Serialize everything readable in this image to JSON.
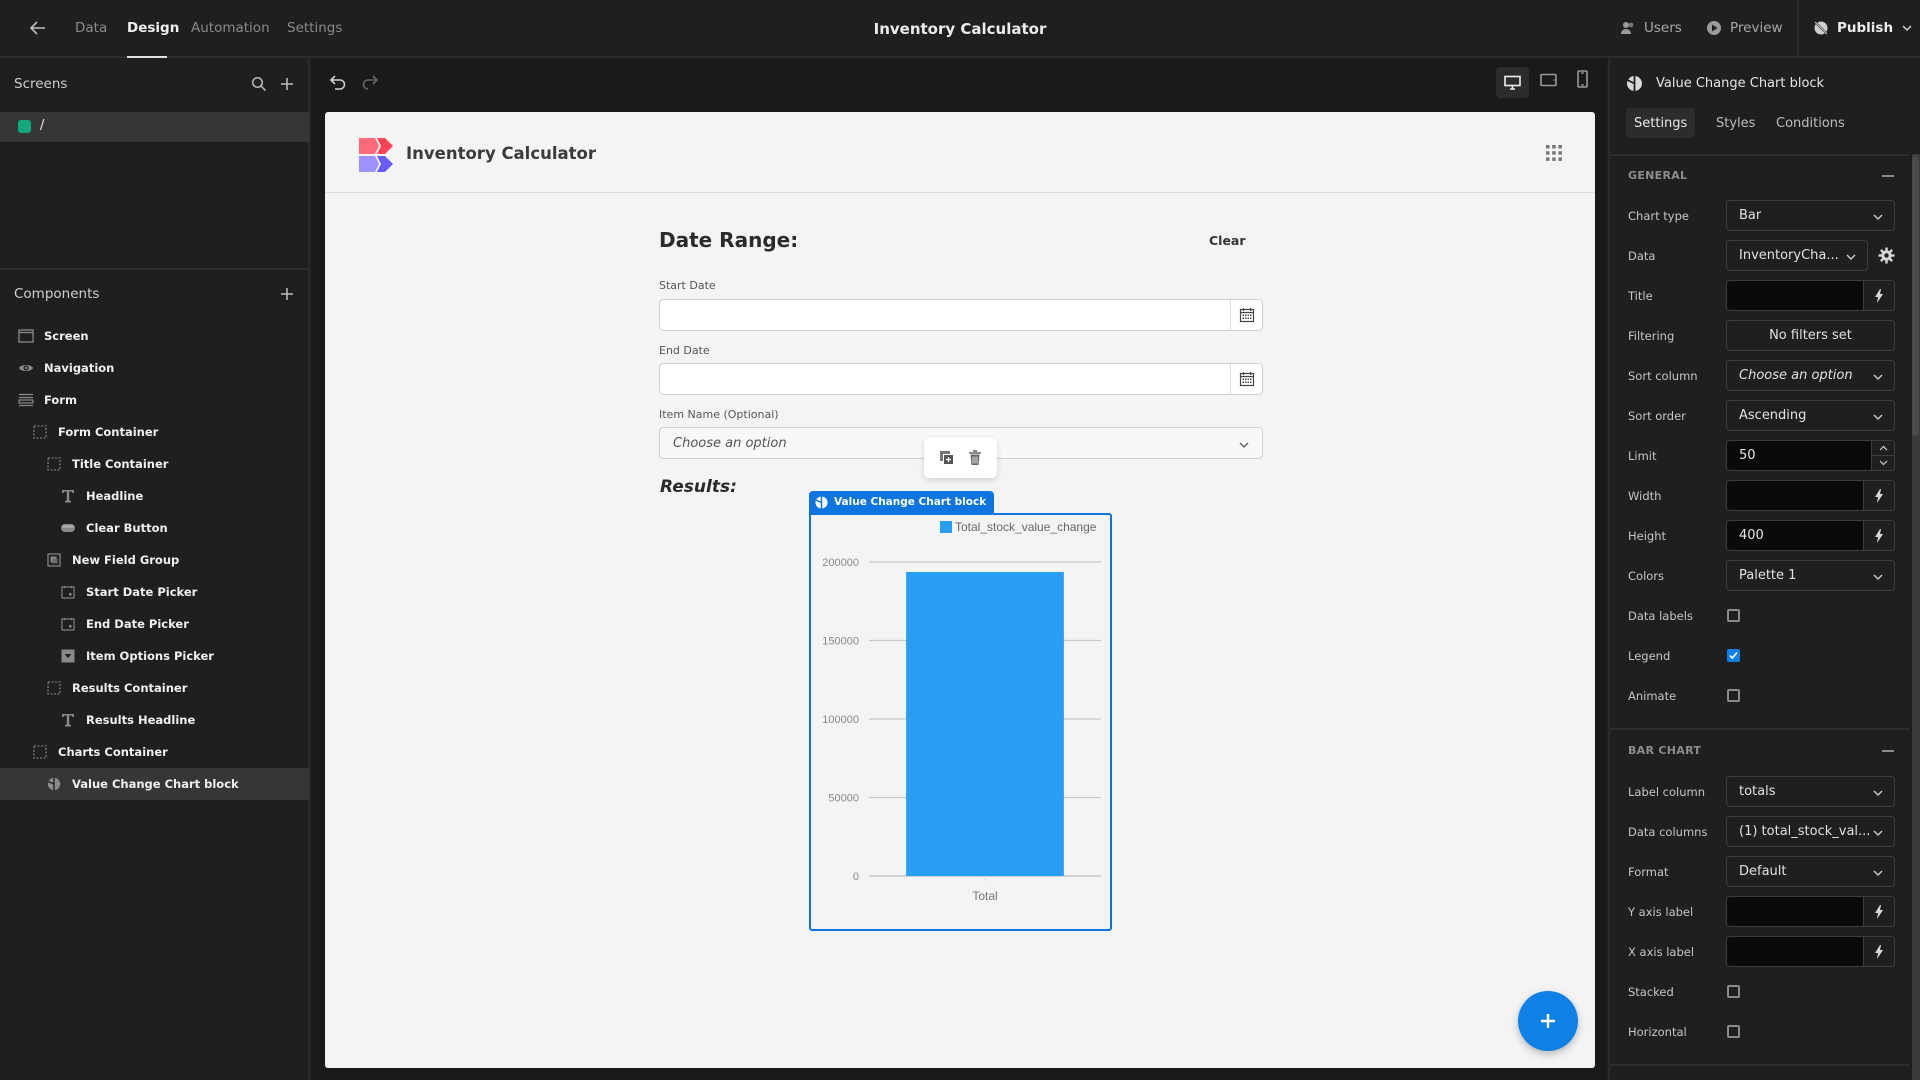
{
  "topbar": {
    "back_icon": "arrow-left-icon",
    "tabs": [
      {
        "label": "Data",
        "active": false
      },
      {
        "label": "Design",
        "active": true
      },
      {
        "label": "Automation",
        "active": false
      },
      {
        "label": "Settings",
        "active": false
      }
    ],
    "app_title": "Inventory Calculator",
    "users_label": "Users",
    "preview_label": "Preview",
    "publish_label": "Publish"
  },
  "left_panel": {
    "screens_heading": "Screens",
    "screens": [
      {
        "label": "/",
        "color": "#12a87d",
        "selected": true
      }
    ],
    "components_heading": "Components",
    "components": [
      {
        "label": "Screen",
        "icon": "screen-icon",
        "depth": 0,
        "selected": false
      },
      {
        "label": "Navigation",
        "icon": "eye-icon",
        "depth": 0,
        "selected": false
      },
      {
        "label": "Form",
        "icon": "form-icon",
        "depth": 0,
        "selected": false
      },
      {
        "label": "Form Container",
        "icon": "container-icon",
        "depth": 1,
        "selected": false
      },
      {
        "label": "Title Container",
        "icon": "container-icon",
        "depth": 2,
        "selected": false
      },
      {
        "label": "Headline",
        "icon": "text-icon",
        "depth": 3,
        "selected": false
      },
      {
        "label": "Clear Button",
        "icon": "button-icon",
        "depth": 3,
        "selected": false
      },
      {
        "label": "New Field Group",
        "icon": "field-group-icon",
        "depth": 2,
        "selected": false
      },
      {
        "label": "Start Date Picker",
        "icon": "date-picker-icon",
        "depth": 3,
        "selected": false
      },
      {
        "label": "End Date Picker",
        "icon": "date-picker-icon",
        "depth": 3,
        "selected": false
      },
      {
        "label": "Item Options Picker",
        "icon": "options-picker-icon",
        "depth": 3,
        "selected": false
      },
      {
        "label": "Results Container",
        "icon": "container-icon",
        "depth": 2,
        "selected": false
      },
      {
        "label": "Results Headline",
        "icon": "text-icon",
        "depth": 3,
        "selected": false
      },
      {
        "label": "Charts Container",
        "icon": "container-icon",
        "depth": 1,
        "selected": false
      },
      {
        "label": "Value Change Chart block",
        "icon": "chart-block-icon",
        "depth": 2,
        "selected": true
      }
    ]
  },
  "canvas": {
    "app_name": "Inventory Calculator",
    "form": {
      "title": "Date Range:",
      "clear_label": "Clear",
      "start_date_label": "Start Date",
      "start_date_value": "",
      "end_date_label": "End Date",
      "end_date_value": "",
      "item_label": "Item Name (Optional)",
      "item_placeholder": "Choose an option"
    },
    "results_title": "Results:",
    "chart_block_tag": "Value Change Chart block"
  },
  "chart_data": {
    "type": "bar",
    "title": "",
    "categories": [
      "Total"
    ],
    "series": [
      {
        "name": "Total_stock_value_change",
        "values": [
          193600
        ],
        "color": "#279ef2"
      }
    ],
    "xlabel": "",
    "ylabel": "",
    "ylim": [
      0,
      200000
    ],
    "yticks": [
      0,
      50000,
      100000,
      150000,
      200000
    ],
    "ytick_labels": [
      "0",
      "50000",
      "100000",
      "150000",
      "200000"
    ],
    "grid": true,
    "legend": "top-right"
  },
  "right_panel": {
    "title": "Value Change Chart block",
    "tabs": [
      {
        "label": "Settings",
        "active": true
      },
      {
        "label": "Styles",
        "active": false
      },
      {
        "label": "Conditions",
        "active": false
      }
    ],
    "general": {
      "heading": "GENERAL",
      "chart_type": {
        "label": "Chart type",
        "value": "Bar"
      },
      "data": {
        "label": "Data",
        "value": "InventoryCha..."
      },
      "title": {
        "label": "Title",
        "value": ""
      },
      "filtering": {
        "label": "Filtering",
        "value": "No filters set"
      },
      "sort_column": {
        "label": "Sort column",
        "placeholder": "Choose an option"
      },
      "sort_order": {
        "label": "Sort order",
        "value": "Ascending"
      },
      "limit": {
        "label": "Limit",
        "value": "50"
      },
      "width": {
        "label": "Width",
        "value": ""
      },
      "height": {
        "label": "Height",
        "value": "400"
      },
      "colors": {
        "label": "Colors",
        "value": "Palette 1"
      },
      "data_labels": {
        "label": "Data labels",
        "checked": false
      },
      "legend": {
        "label": "Legend",
        "checked": true
      },
      "animate": {
        "label": "Animate",
        "checked": false
      }
    },
    "bar_chart": {
      "heading": "BAR CHART",
      "label_column": {
        "label": "Label column",
        "value": "totals"
      },
      "data_columns": {
        "label": "Data columns",
        "value": "(1) total_stock_val..."
      },
      "format": {
        "label": "Format",
        "value": "Default"
      },
      "y_axis_label": {
        "label": "Y axis label",
        "value": ""
      },
      "x_axis_label": {
        "label": "X axis label",
        "value": ""
      },
      "stacked": {
        "label": "Stacked",
        "checked": false
      },
      "horizontal": {
        "label": "Horizontal",
        "checked": false
      }
    }
  }
}
